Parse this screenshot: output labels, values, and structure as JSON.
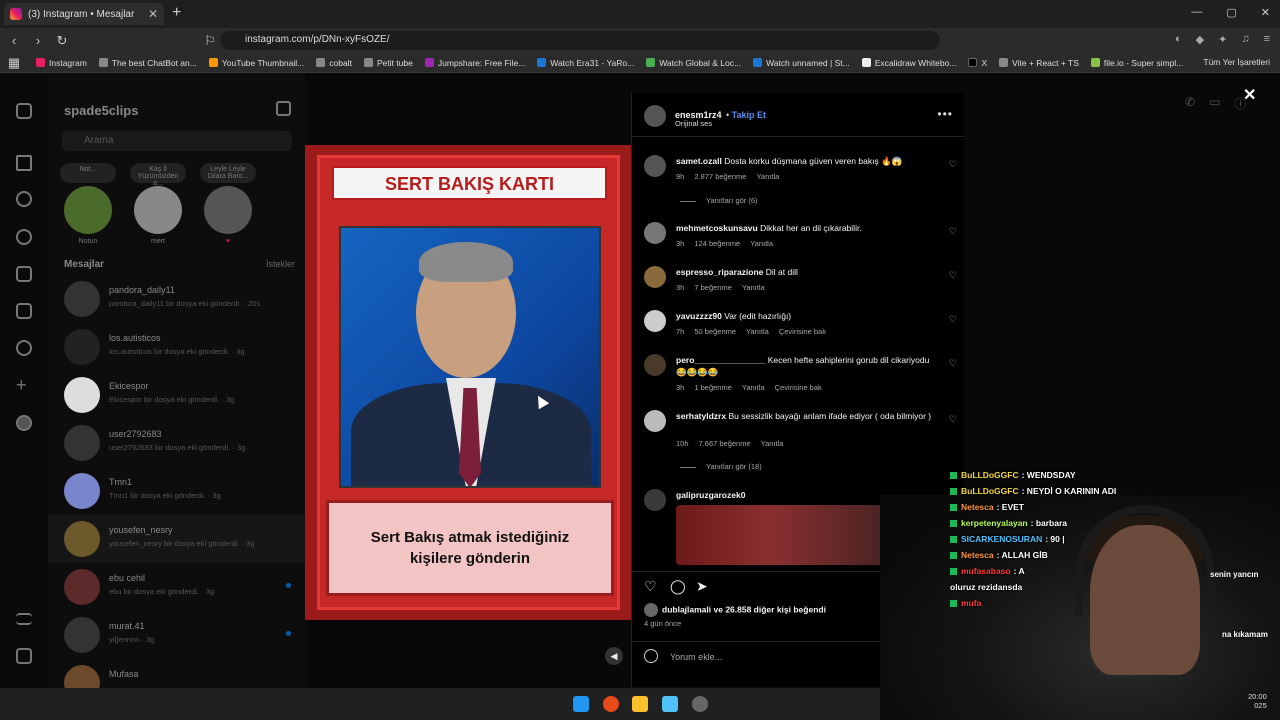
{
  "browser": {
    "tab_title": "(3) Instagram • Mesajlar",
    "url": "instagram.com/p/DNn-xyFsOZE/",
    "bookmarks": [
      "Instagram",
      "The best ChatBot an...",
      "YouTube Thumbnail...",
      "cobalt",
      "Petit tube",
      "Jumpshare: Free File...",
      "Watch Era31 - YaRo...",
      "Watch Global & Loc...",
      "Watch unnamed | St...",
      "Excalidraw Whitebo...",
      "X",
      "Vite + React + TS",
      "file.io - Super simpl..."
    ],
    "bookmarks_all": "Tüm Yer İşaretleri"
  },
  "dm": {
    "account": "spade5clips",
    "search_placeholder": "Arama",
    "notes": [
      {
        "bubble": "Not...",
        "label": "Notun"
      },
      {
        "bubble": "Kaş İl\nYüzümüzden a...",
        "label": "mert"
      },
      {
        "bubble": "Leyle Leyle\nDilara Baro...",
        "label": "♥"
      }
    ],
    "messages_header": "Mesajlar",
    "requests": "İstekler",
    "conversations": [
      {
        "name": "pandora_daily11",
        "sub": "pandora_daily11 bir dosya eki gönderdi. · 20s"
      },
      {
        "name": "los.autisticos",
        "sub": "los.autisticos bir dosya eki gönderdi. · 3g"
      },
      {
        "name": "Ekicespor",
        "sub": "Ekicespor bir dosya eki gönderdi. · 3g"
      },
      {
        "name": "user2792683",
        "sub": "user2792683 bir dosya eki gönderdi. · 3g"
      },
      {
        "name": "Tmn1",
        "sub": "Tmn1 bir dosya eki gönderdi. · 3g"
      },
      {
        "name": "yousefen_nesry",
        "sub": "yousefen_nesry bir dosya eki gönderdi. · 3g"
      },
      {
        "name": "ebu cehil",
        "sub": "ebu bir dosya eki gönderdi. · 3g"
      },
      {
        "name": "murat.41",
        "sub": "yiğennnn · 3g"
      },
      {
        "name": "Mufasa",
        "sub": ""
      }
    ]
  },
  "card": {
    "title": "SERT BAKIŞ KARTI",
    "caption": "Sert Bakış atmak istediğiniz kişilere gönderin"
  },
  "post": {
    "author": "enesm1rz4",
    "follow_label": "Takip Et",
    "audio": "Orijinal ses",
    "comments": [
      {
        "user": "samet.ozall",
        "text": "Dosta korku düşmana güven veren bakış 🔥😱",
        "time": "9h",
        "likes": "2.877 beğenme",
        "reply": "Yanıtla",
        "translate": ""
      },
      {
        "user": "mehmetcoskunsavu",
        "text": "Dikkat her an dil çıkarabilir.",
        "time": "3h",
        "likes": "124 beğenme",
        "reply": "Yanıtla",
        "translate": ""
      },
      {
        "user": "espresso_riparazione",
        "text": "Dil at dill",
        "time": "3h",
        "likes": "7 beğenme",
        "reply": "Yanıtla",
        "translate": ""
      },
      {
        "user": "yavuzzzz90",
        "text": "Var (edit hazırlığı)",
        "time": "7h",
        "likes": "50 beğenme",
        "reply": "Yanıtla",
        "translate": "Çevirisine bak"
      },
      {
        "user": "pero_______________",
        "text": "Kecen hefte sahiplerini gorub dil cikariyodu 😂😂😂😂",
        "time": "3h",
        "likes": "1 beğenme",
        "reply": "Yanıtla",
        "translate": "Çevirisine bak"
      },
      {
        "user": "serhatyldzrx",
        "text": "Bu sessizlik bayağı anlam ifade ediyor ( oda bilmiyor )",
        "time": "10h",
        "likes": "7.667 beğenme",
        "reply": "Yanıtla",
        "translate": ""
      },
      {
        "user": "galipruzgarozek0",
        "text": "",
        "time": "",
        "likes": "",
        "reply": "",
        "translate": ""
      }
    ],
    "replies_6": "Yanıtları gör (6)",
    "replies_18": "Yanıtları gör (18)",
    "liked_by_user": "dublajlamali",
    "liked_by_rest": "ve 26.858 diğer kişi beğendi",
    "ago": "4 gün önce",
    "add_comment_placeholder": "Yorum ekle..."
  },
  "stream_chat": [
    {
      "user": "BuLLDoGGFC",
      "msg": ": WENDSDAY",
      "color": "#f5d742"
    },
    {
      "user": "BuLLDoGGFC",
      "msg": ": NEYDİ O KARININ ADI",
      "color": "#f5d742"
    },
    {
      "user": "Netesca",
      "msg": ": EVET",
      "color": "#ff9a3c"
    },
    {
      "user": "kerpetenyalayan",
      "msg": ": barbara",
      "color": "#b5ff5a"
    },
    {
      "user": "SICARKENOSURAN",
      "msg": ": 90 |",
      "color": "#4fc3ff"
    },
    {
      "user": "Netesca",
      "msg": ": ALLAH GİB",
      "color": "#ff9a3c"
    },
    {
      "user": "mufasabaso",
      "msg": ": A",
      "color": "#ff3b3b"
    },
    {
      "user": "oluruz rezidansda",
      "msg": "",
      "color": "#ffffff"
    },
    {
      "user": "mufa",
      "msg": "",
      "color": "#ff3b3b"
    }
  ],
  "webcam_text": {
    "line1": "senin yancın",
    "line2": "na kıkamam"
  },
  "clock": {
    "time": "20:00",
    "date": "025"
  }
}
